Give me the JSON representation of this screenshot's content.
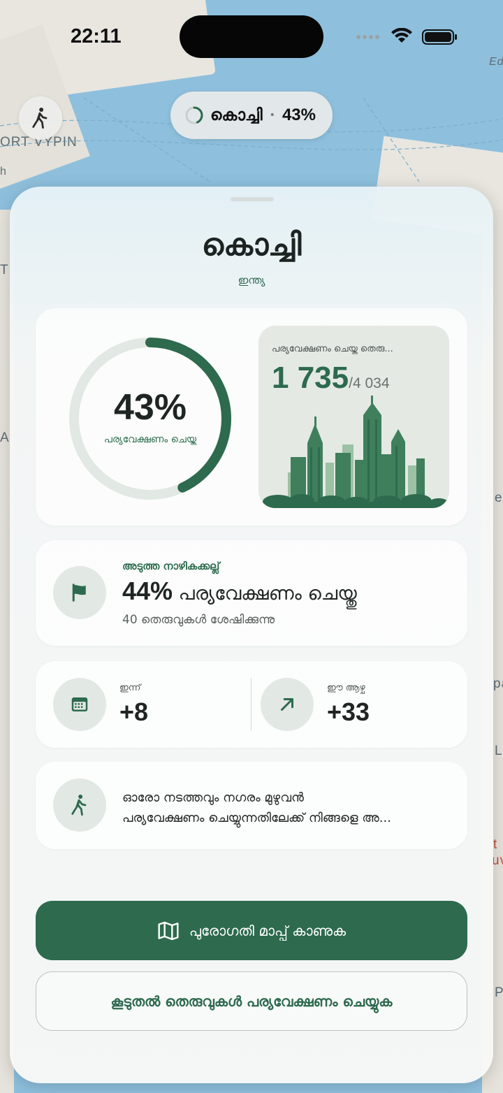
{
  "status_bar": {
    "time": "22:11"
  },
  "map": {
    "labels": [
      "ORT VYPIN",
      "Ed",
      "h",
      "T",
      "AI",
      "e",
      "pa",
      "L",
      "t",
      "uv",
      "P"
    ]
  },
  "city_pill": {
    "name": "കൊച്ചി",
    "progress": "43%",
    "progress_value": 0.43
  },
  "header": {
    "city": "കൊച്ചി",
    "country": "ഇന്ത്യ"
  },
  "progress_card": {
    "percent": "43%",
    "percent_value": 0.43,
    "caption": "പര്യവേക്ഷണം ചെയ്തു",
    "streets_title": "പര്യവേക്ഷണം ചെയ്ത തെരു...",
    "streets_explored": "1 735",
    "streets_total": "/4 034"
  },
  "milestone": {
    "kicker": "അടുത്ത നാഴികക്കല്ല്",
    "percent": "44%",
    "label": "പര്യവേക്ഷണം ചെയ്തു",
    "remaining": "40 തെരുവുകൾ ശേഷിക്കുന്നു"
  },
  "stats": {
    "today_label": "ഇന്ന്",
    "today_value": "+8",
    "week_label": "ഈ ആഴ്ച",
    "week_value": "+33"
  },
  "tip": {
    "line1": "ഓരോ നടത്തവും നഗരം മുഴുവൻ",
    "line2": "പര്യവേക്ഷണം ചെയ്യുന്നതിലേക്ക് നിങ്ങളെ അ..."
  },
  "actions": {
    "primary": "പുരോഗതി മാപ്പ് കാണുക",
    "secondary": "കൂടുതൽ തെരുവുകൾ പര്യവേക്ഷണം ചെയ്യുക"
  },
  "colors": {
    "accent": "#2d6a4e",
    "ring_track": "#e2e8e4",
    "water": "#8ec0dd"
  },
  "icons": [
    "walk-icon",
    "flag-icon",
    "calendar-icon",
    "trend-arrow-icon",
    "map-icon",
    "loading-ring-icon"
  ]
}
